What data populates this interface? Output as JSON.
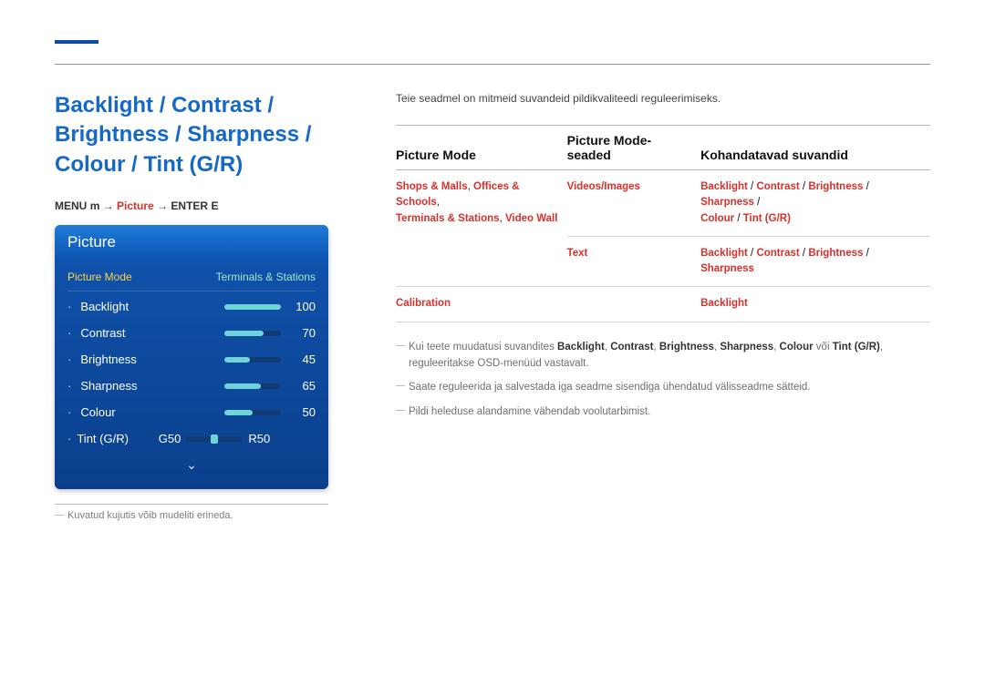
{
  "heading": "Backlight / Contrast / Brightness / Sharpness / Colour / Tint (G/R)",
  "menupath": {
    "menu": "MENU",
    "m_icon": "m",
    "arrow": "→",
    "picture": "Picture",
    "enter": "ENTER",
    "e_icon": "E"
  },
  "osd": {
    "title": "Picture",
    "mode_label": "Picture Mode",
    "mode_value": "Terminals & Stations",
    "rows": [
      {
        "name": "Backlight",
        "value": 100
      },
      {
        "name": "Contrast",
        "value": 70
      },
      {
        "name": "Brightness",
        "value": 45
      },
      {
        "name": "Sharpness",
        "value": 65
      },
      {
        "name": "Colour",
        "value": 50
      }
    ],
    "tint": {
      "name": "Tint (G/R)",
      "left": "G50",
      "right": "R50"
    },
    "more": "⌄"
  },
  "image_note": "Kuvatud kujutis võib mudeliti erineda.",
  "right": {
    "intro": "Teie seadmel on mitmeid suvandeid pildikvaliteedi reguleerimiseks.",
    "table": {
      "headers": [
        "Picture Mode",
        "Picture Mode-seaded",
        "Kohandatavad suvandid"
      ],
      "rows": [
        {
          "c1a": "Shops & Malls",
          "c1b": "Offices & Schools",
          "c1c": "Terminals & Stations",
          "c1d": "Video Wall",
          "c2": "Videos/Images",
          "c3a": "Backlight",
          "c3b": "Contrast",
          "c3c": "Brightness",
          "c3d": "Sharpness",
          "c3e": "Colour",
          "c3f": "Tint (G/R)"
        },
        {
          "c2": "Text",
          "c3a": "Backlight",
          "c3b": "Contrast",
          "c3c": "Brightness",
          "c3d": "Sharpness"
        },
        {
          "c1": "Calibration",
          "c3": "Backlight"
        }
      ]
    },
    "notes": [
      {
        "pre": "Kui teete muudatusi suvandites ",
        "bolds": "Backlight, Contrast, Brightness, Sharpness, Colour",
        "mid": " või ",
        "bold2": "Tint (G/R)",
        "post": ", reguleeritakse OSD-menüüd vastavalt."
      },
      {
        "text": "Saate reguleerida ja salvestada iga seadme sisendiga ühendatud välisseadme sätteid."
      },
      {
        "text": "Pildi heleduse alandamine vähendab voolutarbimist."
      }
    ]
  }
}
